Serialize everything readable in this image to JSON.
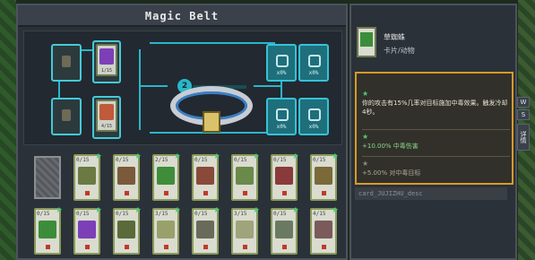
{
  "panel": {
    "title": "Magic Belt"
  },
  "belt": {
    "locked_slots": 4,
    "unlocked_slot_labels": [
      "x0%",
      "x0%",
      "x0%",
      "x0%"
    ],
    "plus_label": "2",
    "equipped": [
      {
        "count": "1/15",
        "art_color": "#7d3fb8"
      },
      {
        "count": "4/15",
        "art_color": "#c05a3a"
      }
    ]
  },
  "grid": {
    "cards": [
      {
        "count": "0/15",
        "art_color": "#6a7a42"
      },
      {
        "count": "0/15",
        "art_color": "#7a5a3a"
      },
      {
        "count": "2/15",
        "art_color": "#3f8d3a"
      },
      {
        "count": "0/15",
        "art_color": "#8a4a3a"
      },
      {
        "count": "0/15",
        "art_color": "#6a8a4a"
      },
      {
        "count": "0/15",
        "art_color": "#8a3a3a"
      },
      {
        "count": "0/15",
        "art_color": "#7a6a3a"
      },
      {
        "count": "0/15",
        "art_color": "#3c8d3a"
      },
      {
        "count": "0/15",
        "art_color": "#7d3fb8"
      },
      {
        "count": "0/15",
        "art_color": "#5a6a3a"
      },
      {
        "count": "3/15",
        "art_color": "#9aa06a"
      },
      {
        "count": "0/15",
        "art_color": "#6a6a5a"
      },
      {
        "count": "3/15",
        "art_color": "#a0a47a"
      },
      {
        "count": "0/15",
        "art_color": "#6a7a62"
      },
      {
        "count": "4/15",
        "art_color": "#7a5a5a"
      },
      {
        "count": "0/15",
        "art_color": "#5a7a3a"
      }
    ]
  },
  "detail": {
    "name": "草蜘蛛",
    "type": "卡片/动物",
    "effect_text": "你的攻击有15%几率对目标施加中毒效果。触发冷却4秒。",
    "bonus_text": "+10.00% 中毒伤害",
    "extra_text": "+5.00% 对中毒目标",
    "card_id": "card_JUJIZHU_desc"
  },
  "tabs": {
    "tab_a": "W",
    "tab_b": "S",
    "tab_c": "详情"
  },
  "colors": {
    "accent": "#2bb5c9",
    "highlight": "#d89a2a"
  }
}
